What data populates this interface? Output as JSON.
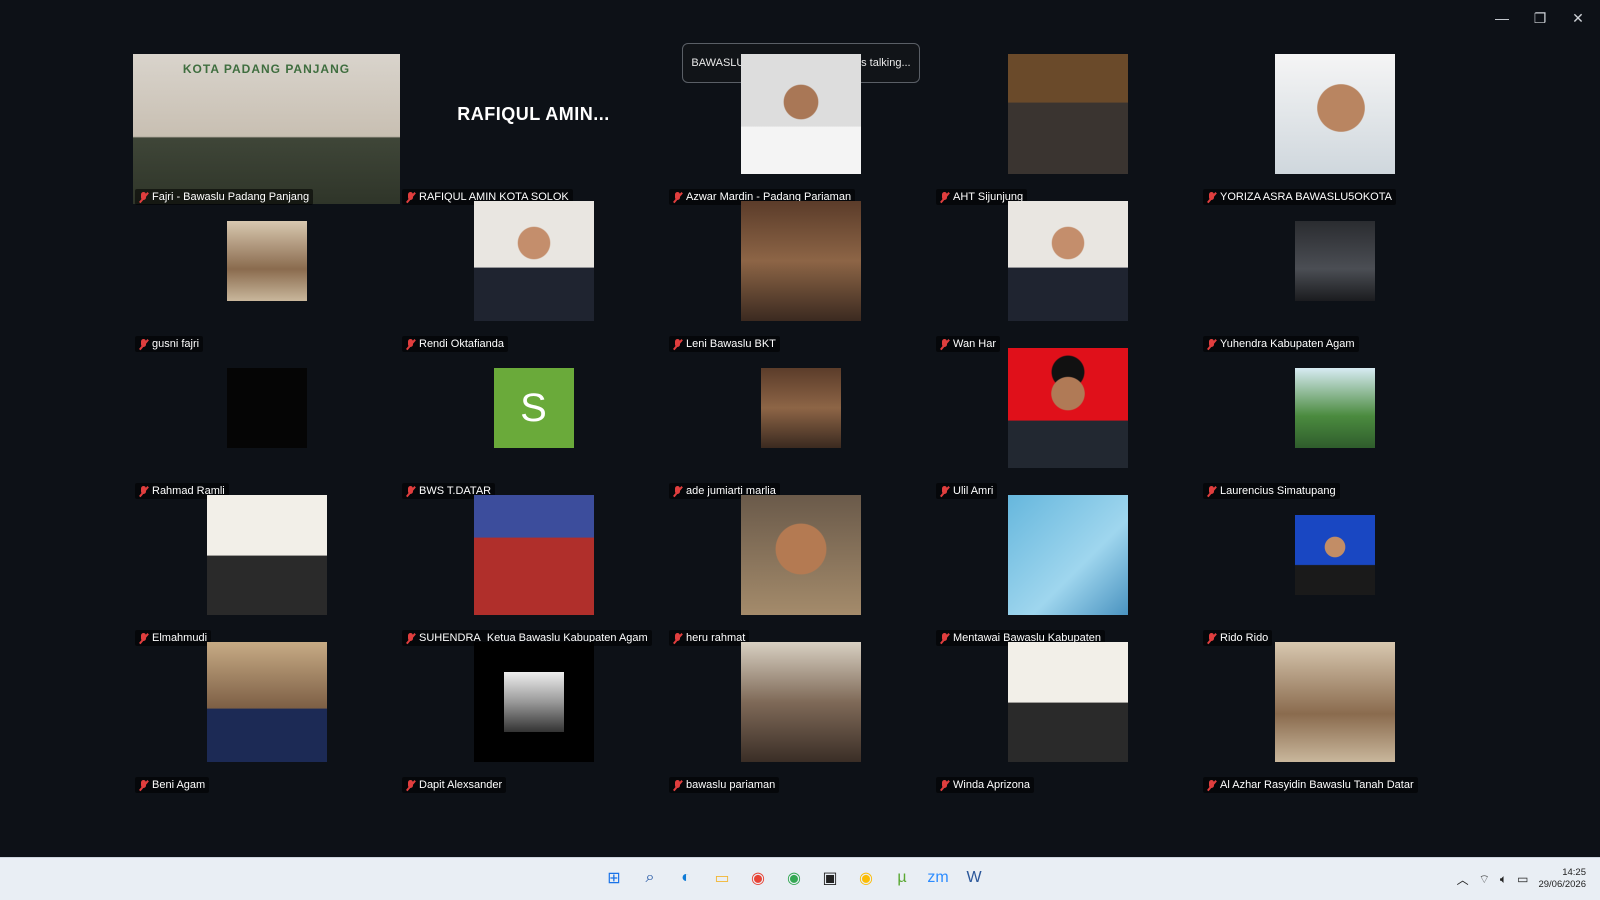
{
  "window": {
    "minimize_glyph": "—",
    "restore_glyph": "❐",
    "close_glyph": "✕"
  },
  "talking": {
    "text": "BAWASLU KOTA SAWAHLUNTO is talking...",
    "zoom_badge": "zm"
  },
  "participants": [
    {
      "name": "Fajri - Bawaslu Padang Panjang",
      "kind": "wide",
      "photo": "ph-room",
      "overlay": "KOTA PADANG PANJANG"
    },
    {
      "name": "RAFIQUL AMIN KOTA SOLOK",
      "kind": "text",
      "display": "RAFIQUL  AMIN..."
    },
    {
      "name": "Azwar Mardin - Padang Pariaman",
      "kind": "photo",
      "photo": "ph-azwar"
    },
    {
      "name": "AHT Sijunjung",
      "kind": "photo",
      "photo": "ph-deputi"
    },
    {
      "name": "YORIZA ASRA BAWASLU5OKOTA",
      "kind": "photo",
      "photo": "ph-selfie"
    },
    {
      "name": "gusni fajri",
      "kind": "small",
      "photo": "ph-wood"
    },
    {
      "name": "Rendi Oktafianda",
      "kind": "photo",
      "photo": "ph-suit"
    },
    {
      "name": "Leni Bawaslu BKT",
      "kind": "photo",
      "photo": "ph-hall"
    },
    {
      "name": "Wan Har",
      "kind": "photo",
      "photo": "ph-suit"
    },
    {
      "name": "Yuhendra Kabupaten Agam",
      "kind": "small",
      "photo": "ph-car"
    },
    {
      "name": "Rahmad Ramli",
      "kind": "small",
      "photo": "ph-dark"
    },
    {
      "name": "BWS T.DATAR",
      "kind": "letter",
      "letter": "S"
    },
    {
      "name": "ade jumiarti marlia",
      "kind": "small",
      "photo": "ph-hall"
    },
    {
      "name": "Ulil Amri",
      "kind": "photo",
      "photo": "ph-red"
    },
    {
      "name": "Laurencius Simatupang",
      "kind": "small",
      "photo": "ph-green"
    },
    {
      "name": "Elmahmudi",
      "kind": "photo",
      "photo": "ph-white"
    },
    {
      "name": "SUHENDRA_Ketua Bawaslu Kabupaten Agam",
      "kind": "photo",
      "photo": "ph-stage"
    },
    {
      "name": "heru rahmat",
      "kind": "photo",
      "photo": "ph-face"
    },
    {
      "name": "Mentawai Bawaslu Kabupaten",
      "kind": "photo",
      "photo": "ph-bluesc"
    },
    {
      "name": "Rido Rido",
      "kind": "small",
      "photo": "ph-blue"
    },
    {
      "name": "Beni Agam",
      "kind": "photo",
      "photo": "ph-office"
    },
    {
      "name": "Dapit Alexsander",
      "kind": "frame",
      "photo": "ph-frame"
    },
    {
      "name": "bawaslu pariaman",
      "kind": "photo",
      "photo": "ph-crowd"
    },
    {
      "name": "Winda Aprizona",
      "kind": "photo",
      "photo": "ph-white"
    },
    {
      "name": "Al Azhar Rasyidin Bawaslu Tanah Datar",
      "kind": "photo",
      "photo": "ph-wood"
    }
  ],
  "taskbar": {
    "icons": [
      {
        "name": "windows-start-icon",
        "glyph": "⊞",
        "color": "#1a73e8"
      },
      {
        "name": "search-icon",
        "glyph": "⌕",
        "color": "#1a4fa0"
      },
      {
        "name": "edge-icon",
        "glyph": "◐",
        "color": "#0f7bd6"
      },
      {
        "name": "file-explorer-icon",
        "glyph": "▭",
        "color": "#f2b632"
      },
      {
        "name": "chrome-icon",
        "glyph": "◉",
        "color": "#e84335"
      },
      {
        "name": "chrome-profile-icon",
        "glyph": "◉",
        "color": "#34a853"
      },
      {
        "name": "meet-icon",
        "glyph": "▣",
        "color": "#222"
      },
      {
        "name": "chrome-alt-icon",
        "glyph": "◉",
        "color": "#fbbc04"
      },
      {
        "name": "utorrent-icon",
        "glyph": "µ",
        "color": "#5aa832"
      },
      {
        "name": "zoom-icon",
        "glyph": "zm",
        "color": "#2d8cff"
      },
      {
        "name": "word-icon",
        "glyph": "W",
        "color": "#2b579a"
      }
    ],
    "time": "14:25",
    "date": "29/06/2026"
  }
}
